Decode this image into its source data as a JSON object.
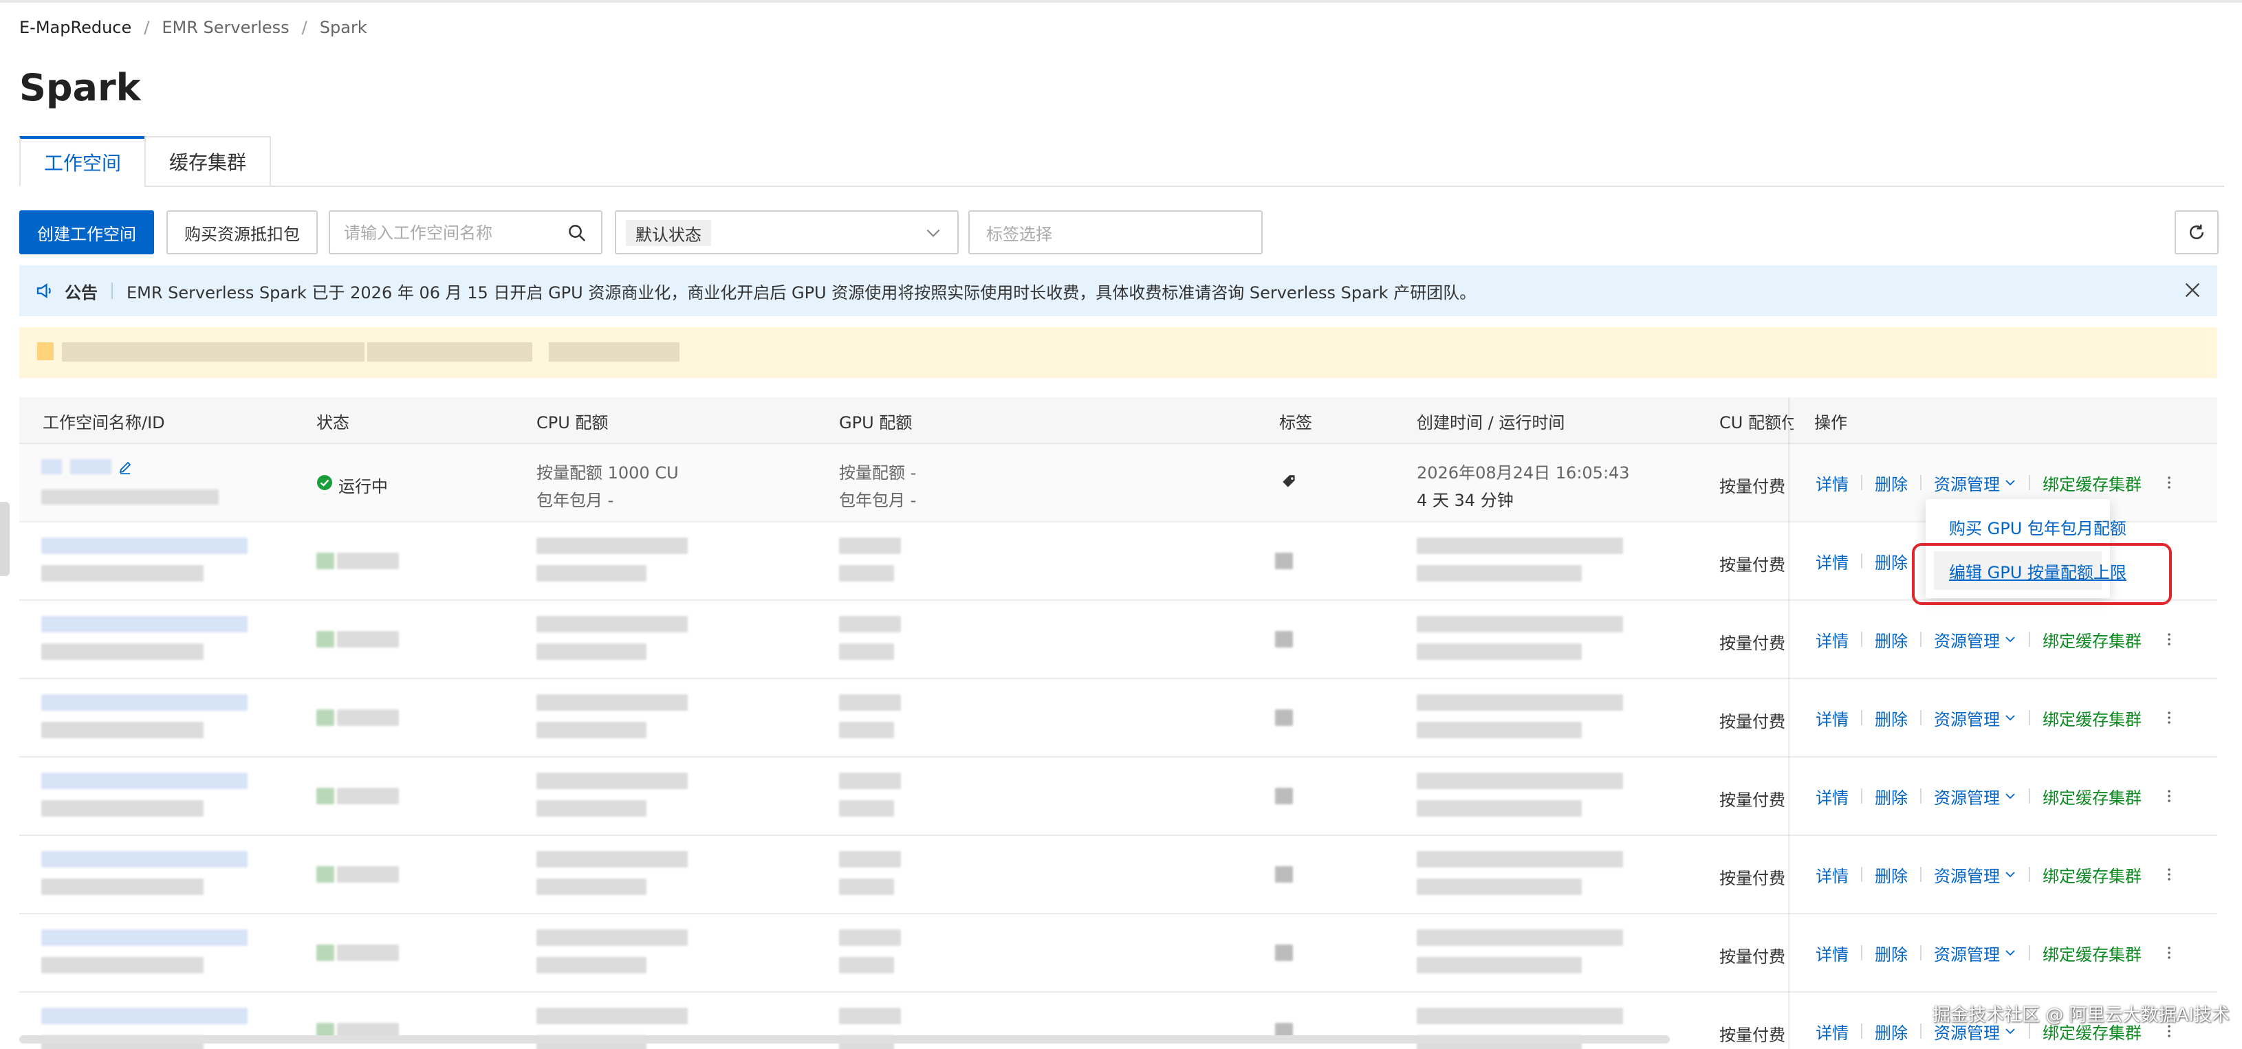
{
  "breadcrumb": {
    "items": [
      "E-MapReduce",
      "EMR Serverless",
      "Spark"
    ],
    "separator": "/"
  },
  "page": {
    "title": "Spark"
  },
  "tabs": [
    {
      "label": "工作空间",
      "active": true
    },
    {
      "label": "缓存集群",
      "active": false
    }
  ],
  "toolbar": {
    "create_label": "创建工作空间",
    "buy_label": "购买资源抵扣包",
    "search_placeholder": "请输入工作空间名称",
    "status_value": "默认状态",
    "tag_placeholder": "标签选择"
  },
  "notice": {
    "label": "公告",
    "text": "EMR Serverless Spark 已于 2026 年 06 月 15 日开启 GPU 资源商业化，商业化开启后 GPU 资源使用将按照实际使用时长收费，具体收费标准请咨询 Serverless Spark 产研团队。"
  },
  "table": {
    "columns": [
      "工作空间名称/ID",
      "状态",
      "CPU 配额",
      "GPU 配额",
      "标签",
      "创建时间 / 运行时间",
      "CU 配额付",
      "操作"
    ],
    "first_row": {
      "status": "运行中",
      "cpu_line1": "按量配额 1000 CU",
      "cpu_line2": "包年包月 -",
      "gpu_line1": "按量配额 -",
      "gpu_line2": "包年包月 -",
      "created": "2026年08月24日 16:05:43",
      "runtime": "4 天 34 分钟",
      "billing": "按量付费"
    },
    "billing_label": "按量付费",
    "ops": {
      "detail": "详情",
      "delete": "删除",
      "resource": "资源管理",
      "bind": "绑定缓存集群"
    }
  },
  "menu": {
    "items": [
      "购买 GPU 包年包月配额",
      "编辑 GPU 按量配额上限"
    ],
    "highlighted_index": 1
  },
  "watermark": "掘金技术社区 @ 阿里云大数据AI技术",
  "colors": {
    "primary": "#0064c8",
    "notice_bg": "#e6f3fd",
    "warn_bg": "#fff6dc",
    "success": "#1a9e3a",
    "bind_link": "#0b8a1f",
    "highlight": "#e0262b"
  }
}
